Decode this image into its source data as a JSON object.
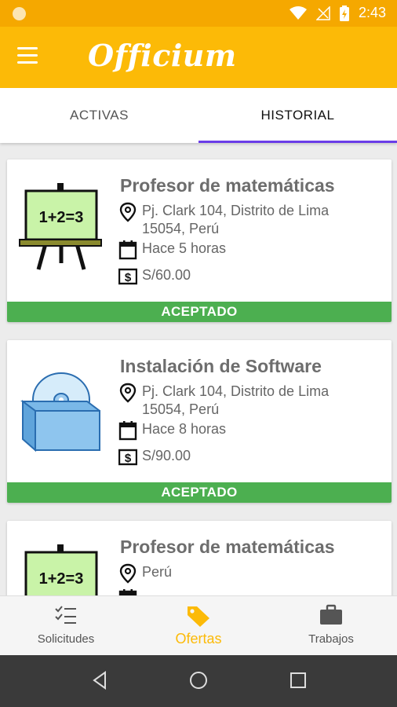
{
  "status_bar": {
    "time": "2:43"
  },
  "app_bar": {
    "logo_text": "Officium",
    "menu_icon": "hamburger-menu-icon"
  },
  "tabs": [
    {
      "label": "ACTIVAS",
      "active": false
    },
    {
      "label": "HISTORIAL",
      "active": true
    }
  ],
  "cards": [
    {
      "title": "Profesor de matemáticas",
      "address": "Pj. Clark 104, Distrito de Lima 15054, Perú",
      "time": "Hace 5 horas",
      "price": "S/60.00",
      "status": "ACEPTADO",
      "thumb": "chalkboard-icon",
      "board_text": "1+2=3"
    },
    {
      "title": "Instalación de Software",
      "address": "Pj. Clark 104, Distrito de Lima 15054, Perú",
      "time": "Hace 8 horas",
      "price": "S/90.00",
      "status": "ACEPTADO",
      "thumb": "software-box-icon"
    },
    {
      "title": "Profesor de matemáticas",
      "address": "Perú",
      "thumb": "chalkboard-icon",
      "board_text": "1+2=3"
    }
  ],
  "bottom_nav": [
    {
      "label": "Solicitudes",
      "icon": "checklist-icon",
      "active": false
    },
    {
      "label": "Ofertas",
      "icon": "tag-icon",
      "active": true
    },
    {
      "label": "Trabajos",
      "icon": "briefcase-icon",
      "active": false
    }
  ],
  "colors": {
    "status_bar": "#F5A800",
    "app_bar": "#FCBA07",
    "tab_indicator": "#6A3DE8",
    "accepted": "#4CAF50"
  }
}
